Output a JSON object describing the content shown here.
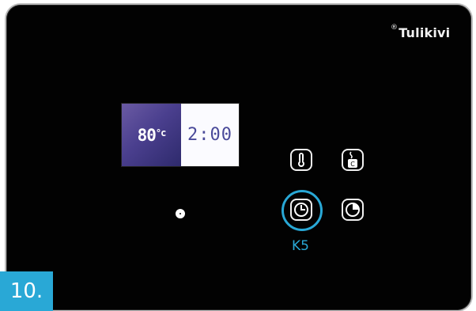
{
  "brand": {
    "mark": "®",
    "name": "Tulikivi"
  },
  "display": {
    "temperature_value": "80",
    "temperature_unit": "°c",
    "time": "2:00"
  },
  "buttons": [
    {
      "icon": "thermometer-icon"
    },
    {
      "icon": "steam-temperature-icon"
    },
    {
      "icon": "timer-clock-icon"
    },
    {
      "icon": "start-time-clock-icon"
    }
  ],
  "highlight": {
    "label": "K5",
    "color": "#29a8d6"
  },
  "step": {
    "label": "10."
  },
  "colors": {
    "panel": "#020202",
    "accent": "#29a8d6",
    "display_left": "#4a3f8e",
    "display_right": "#fbfbff"
  }
}
